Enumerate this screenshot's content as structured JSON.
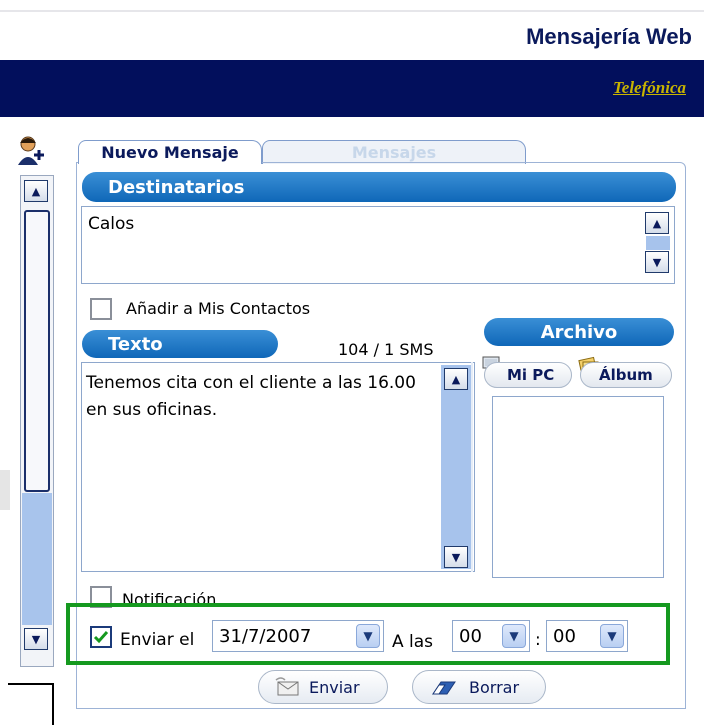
{
  "header": {
    "app_title": "Mensajería Web",
    "brand": "Telefónica"
  },
  "tabs": [
    {
      "label": "Nuevo Mensaje",
      "active": true
    },
    {
      "label": "Mensajes",
      "active": false
    }
  ],
  "destinatarios": {
    "header": "Destinatarios",
    "value": "Calos",
    "add_contacts_label": "Añadir a Mis Contactos",
    "add_contacts_checked": false
  },
  "texto": {
    "header": "Texto",
    "counter": "104 / 1 SMS",
    "value": "Tenemos cita con el cliente a las 16.00 en sus oficinas."
  },
  "archivo": {
    "header": "Archivo",
    "mipc_label": "Mi PC",
    "album_label": "Álbum"
  },
  "options": {
    "notificacion_label": "Notificación",
    "notificacion_checked": false,
    "enviar_el_label": "Enviar el",
    "enviar_el_checked": true,
    "date": "31/7/2007",
    "a_las_label": "A las",
    "hour": "00",
    "time_sep": ":",
    "minute": "00"
  },
  "actions": {
    "send_label": "Enviar",
    "clear_label": "Borrar"
  },
  "colors": {
    "brand_bar": "#020f5c",
    "accent_blue": "#0f67b8",
    "highlight_green": "#15991f"
  }
}
